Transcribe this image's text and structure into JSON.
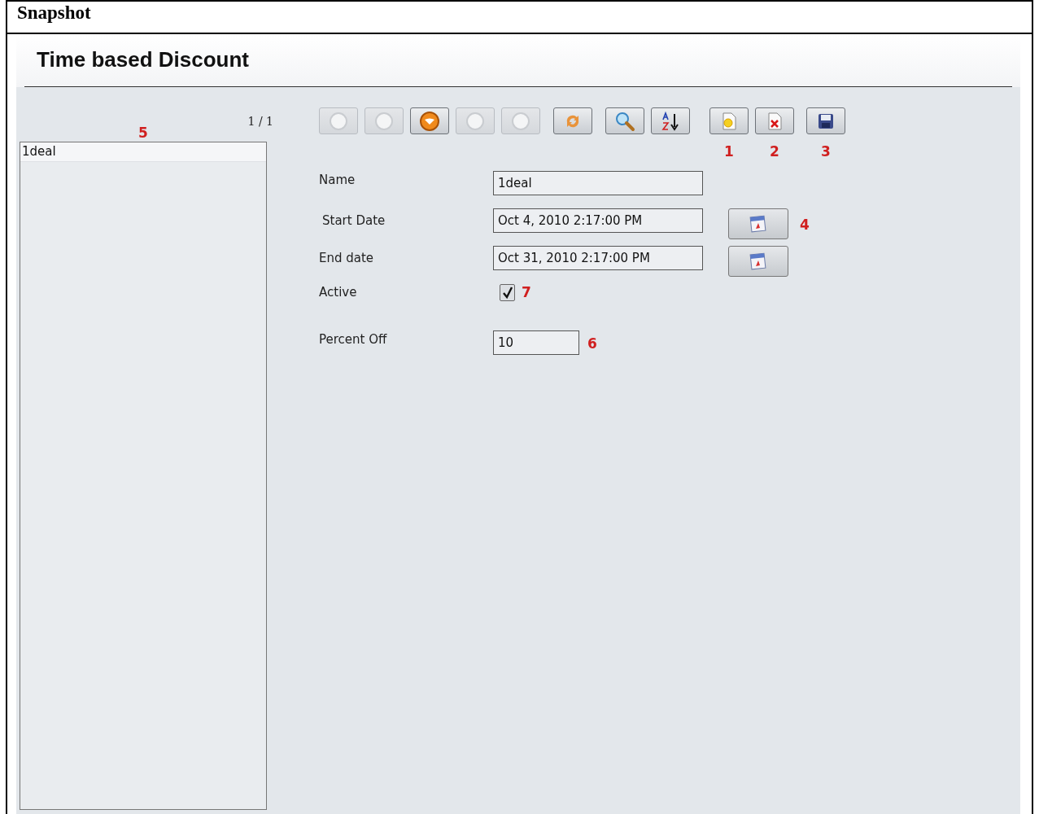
{
  "document": {
    "heading": "Snapshot"
  },
  "panel": {
    "title": "Time based Discount"
  },
  "list": {
    "pager": "1 / 1",
    "callout": "5",
    "items": [
      {
        "label": "1deal",
        "selected": true
      }
    ]
  },
  "toolbar": [
    {
      "kind": "first",
      "disabled": true
    },
    {
      "kind": "previous",
      "disabled": true
    },
    {
      "kind": "current",
      "disabled": false
    },
    {
      "kind": "next",
      "disabled": true
    },
    {
      "kind": "last",
      "disabled": true
    },
    {
      "kind": "refresh",
      "disabled": false
    },
    {
      "kind": "search",
      "disabled": false
    },
    {
      "kind": "sort",
      "disabled": false
    },
    {
      "kind": "new",
      "disabled": false,
      "callout": "1"
    },
    {
      "kind": "delete",
      "disabled": false,
      "callout": "2"
    },
    {
      "kind": "save",
      "disabled": false,
      "callout": "3"
    }
  ],
  "form": [
    {
      "kind": "text",
      "label": "Name",
      "value": "1deal"
    },
    {
      "kind": "date",
      "label": "Start Date",
      "value": "Oct 4, 2010 2:17:00 PM",
      "callout": "4"
    },
    {
      "kind": "date",
      "label": "End date",
      "value": "Oct 31, 2010 2:17:00 PM"
    },
    {
      "kind": "checkbox",
      "label": "Active",
      "checked": true,
      "callout": "7"
    },
    {
      "kind": "short",
      "label": "Percent Off",
      "value": "10",
      "callout": "6"
    }
  ]
}
